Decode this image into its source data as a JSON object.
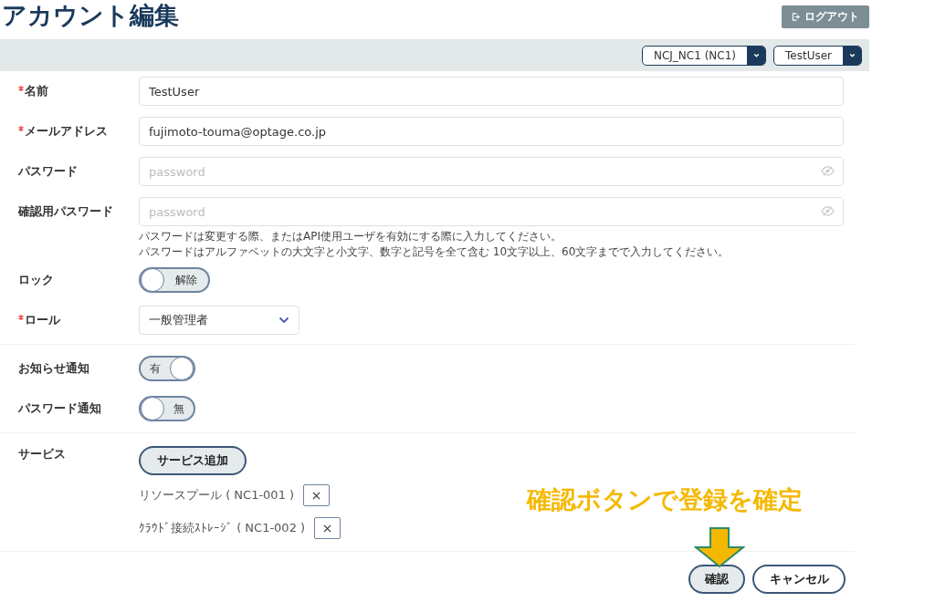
{
  "header": {
    "title": "アカウント編集",
    "logout_button": "ログアウト"
  },
  "toolbar": {
    "selects": [
      {
        "value": "NCJ_NC1 (NC1)"
      },
      {
        "value": "TestUser"
      }
    ]
  },
  "form": {
    "fields": [
      {
        "kind": "text",
        "label": "名前",
        "required": true,
        "value": "TestUser"
      },
      {
        "kind": "text",
        "label": "メールアドレス",
        "required": true,
        "value": "fujimoto-touma@optage.co.jp"
      },
      {
        "kind": "password",
        "label": "パスワード",
        "required": false,
        "placeholder": "password"
      },
      {
        "kind": "password",
        "label": "確認用パスワード",
        "required": false,
        "placeholder": "password"
      }
    ],
    "password_notes": [
      "パスワードは変更する際、またはAPI使用ユーザを有効にする際に入力してください。",
      "パスワードはアルファベットの大文字と小文字、数字と記号を全て含む 10文字以上、60文字までで入力してください。"
    ],
    "lock": {
      "label": "ロック",
      "required": false,
      "on": false,
      "text": "解除"
    },
    "role": {
      "label": "ロール",
      "required": true,
      "value": "一般管理者"
    },
    "notifications": [
      {
        "label": "お知らせ通知",
        "on": true,
        "text": "有"
      },
      {
        "label": "パスワード通知",
        "on": false,
        "text": "無"
      }
    ],
    "services": {
      "label": "サービス",
      "add_button": "サービス追加",
      "items": [
        {
          "name": "リソースプール ( NC1-001 )"
        },
        {
          "name": "ｸﾗｳﾄﾞ接続ｽﾄﾚｰｼﾞ ( NC1-002 )"
        }
      ]
    },
    "buttons": {
      "confirm": "確認",
      "cancel": "キャンセル"
    }
  },
  "annotation": {
    "text": "確認ボタンで登録を確定"
  }
}
